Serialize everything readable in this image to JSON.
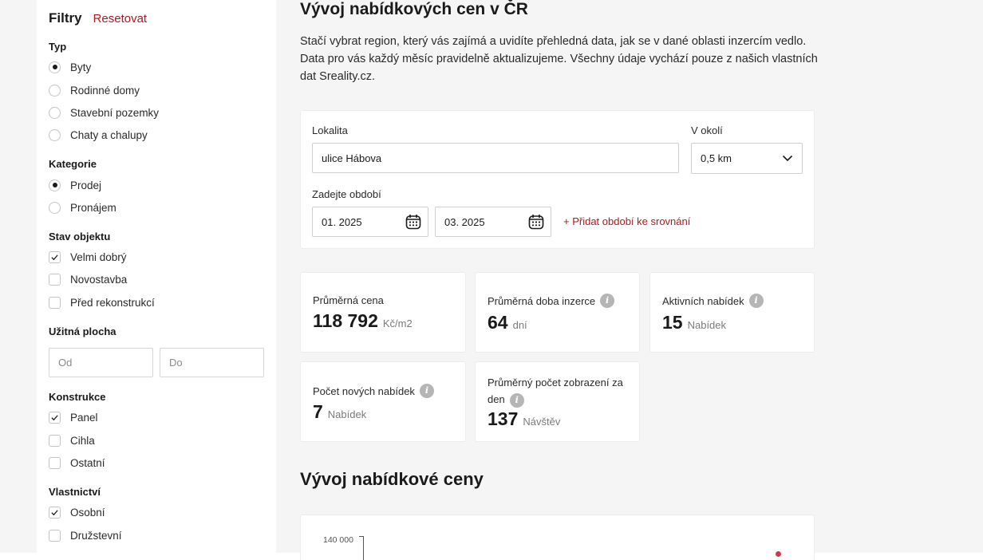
{
  "sidebar": {
    "title": "Filtry",
    "reset": "Resetovat",
    "typ": {
      "title": "Typ",
      "options": [
        "Byty",
        "Rodinné domy",
        "Stavební pozemky",
        "Chaty a chalupy"
      ],
      "selected": "Byty"
    },
    "kategorie": {
      "title": "Kategorie",
      "options": [
        "Prodej",
        "Pronájem"
      ],
      "selected": "Prodej"
    },
    "stav": {
      "title": "Stav objektu",
      "options": [
        "Velmi dobrý",
        "Novostavba",
        "Před rekonstrukcí"
      ],
      "checked": [
        "Velmi dobrý"
      ]
    },
    "plocha": {
      "title": "Užitná plocha",
      "from_placeholder": "Od",
      "to_placeholder": "Do"
    },
    "konstrukce": {
      "title": "Konstrukce",
      "options": [
        "Panel",
        "Cihla",
        "Ostatní"
      ],
      "checked": [
        "Panel"
      ]
    },
    "vlastnictvi": {
      "title": "Vlastnictví",
      "options": [
        "Osobní",
        "Družstevní"
      ],
      "checked": [
        "Osobní"
      ]
    }
  },
  "main": {
    "title": "Vývoj nabídkových cen v ČR",
    "intro": "Stačí vybrat region, který vás zajímá a uvidíte přehledná data, jak se v dané oblasti inzercím vedlo. Data pro vás každý měsíc pravidelně aktualizujeme. Všechny údaje vychází pouze z našich vlastních dat Sreality.cz.",
    "form": {
      "location_label": "Lokalita",
      "location_value": "ulice Hábova",
      "radius_label": "V okolí",
      "radius_value": "0,5 km",
      "period_label": "Zadejte období",
      "date_from": "01. 2025",
      "date_to": "03. 2025",
      "add_period": "+ Přidat období ke srovnání"
    },
    "stats": {
      "avg_price": {
        "label": "Průměrná cena",
        "value": "118 792",
        "unit": "Kč/m2"
      },
      "avg_duration": {
        "label": "Průměrná doba inzerce",
        "value": "64",
        "unit": "dní"
      },
      "active": {
        "label": "Aktivních nabídek",
        "value": "15",
        "unit": "Nabídek"
      },
      "new": {
        "label": "Počet nových nabídek",
        "value": "7",
        "unit": "Nabídek"
      },
      "views_line1": "Průměrný počet zobrazení za",
      "views_line2": "den",
      "views_value": "137",
      "views_unit": "Návštěv"
    },
    "chart_section_title": "Vývoj nabídkové ceny",
    "chart_first_tick": "140 000"
  },
  "colors": {
    "accent": "#b3171f",
    "background": "#f5f5f5",
    "card": "#ffffff"
  }
}
